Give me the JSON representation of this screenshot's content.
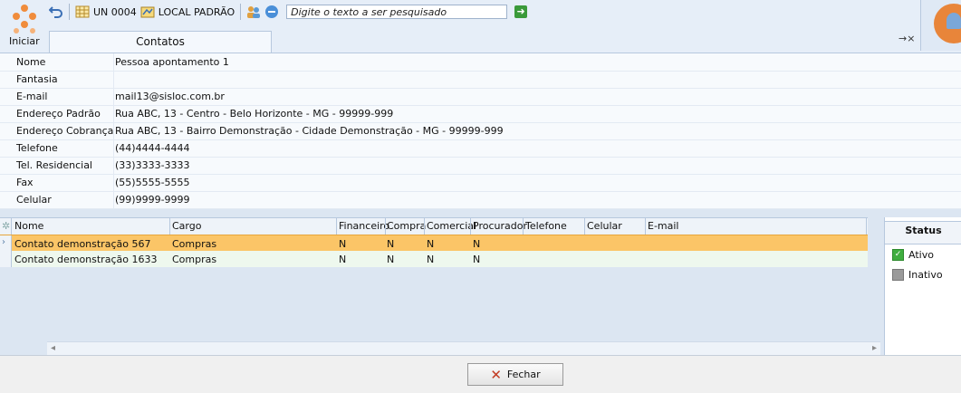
{
  "header": {
    "iniciar": "Iniciar",
    "unit": "UN 0004",
    "location": "LOCAL PADRÃO",
    "search_placeholder": "Digite o texto a ser pesquisado",
    "tab": "Contatos",
    "tab_controls": "→×"
  },
  "form": {
    "rows": [
      {
        "label": "Nome",
        "value": "Pessoa apontamento 1"
      },
      {
        "label": "Fantasia",
        "value": ""
      },
      {
        "label": "E-mail",
        "value": "mail13@sisloc.com.br"
      },
      {
        "label": "Endereço Padrão",
        "value": "Rua ABC, 13 - Centro - Belo Horizonte - MG - 99999-999"
      },
      {
        "label": "Endereço Cobrança",
        "value": "Rua ABC, 13 - Bairro Demonstração - Cidade Demonstração - MG - 99999-999"
      },
      {
        "label": "Telefone",
        "value": "(44)4444-4444"
      },
      {
        "label": "Tel. Residencial",
        "value": "(33)3333-3333"
      },
      {
        "label": "Fax",
        "value": "(55)5555-5555"
      },
      {
        "label": "Celular",
        "value": "(99)9999-9999"
      }
    ]
  },
  "grid": {
    "columns": [
      "Nome",
      "Cargo",
      "Financeiro",
      "Compra",
      "Comercial",
      "Procurador",
      "Telefone",
      "Celular",
      "E-mail"
    ],
    "rows": [
      [
        "Contato demonstração 567",
        "Compras",
        "N",
        "N",
        "N",
        "N",
        "",
        "",
        ""
      ],
      [
        "Contato demonstração 1633",
        "Compras",
        "N",
        "N",
        "N",
        "N",
        "",
        "",
        ""
      ]
    ]
  },
  "status": {
    "title": "Status",
    "ativo": "Ativo",
    "inativo": "Inativo"
  },
  "footer": {
    "fechar": "Fechar"
  }
}
